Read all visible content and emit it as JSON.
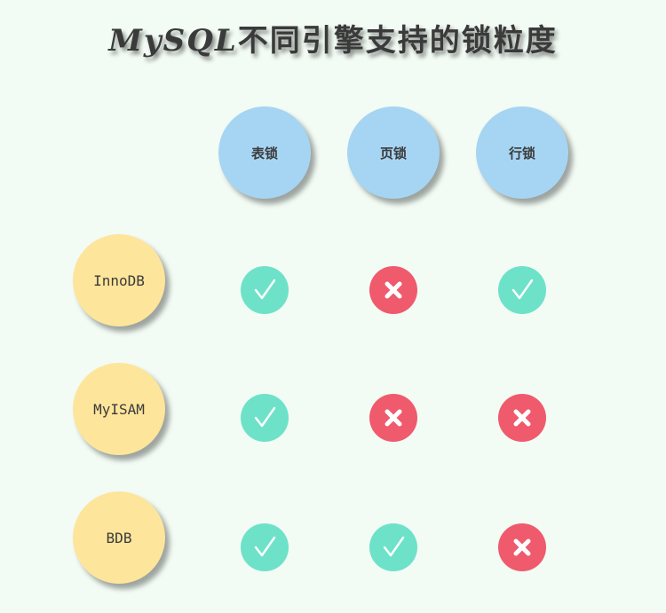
{
  "title": {
    "latin": "MySQL",
    "rest": "不同引擎支持的锁粒度"
  },
  "columns": [
    "表锁",
    "页锁",
    "行锁"
  ],
  "rows": [
    {
      "engine": "InnoDB",
      "support": [
        true,
        false,
        true
      ]
    },
    {
      "engine": "MyISAM",
      "support": [
        true,
        false,
        false
      ]
    },
    {
      "engine": "BDB",
      "support": [
        true,
        true,
        false
      ]
    }
  ],
  "symbols": {
    "supported": "check-icon",
    "unsupported": "cross-icon"
  },
  "colors": {
    "background": "#f2fbf4",
    "column_header": "#a6d5f3",
    "row_header": "#fde59b",
    "supported": "#6de2c9",
    "unsupported": "#ef5a6c"
  }
}
